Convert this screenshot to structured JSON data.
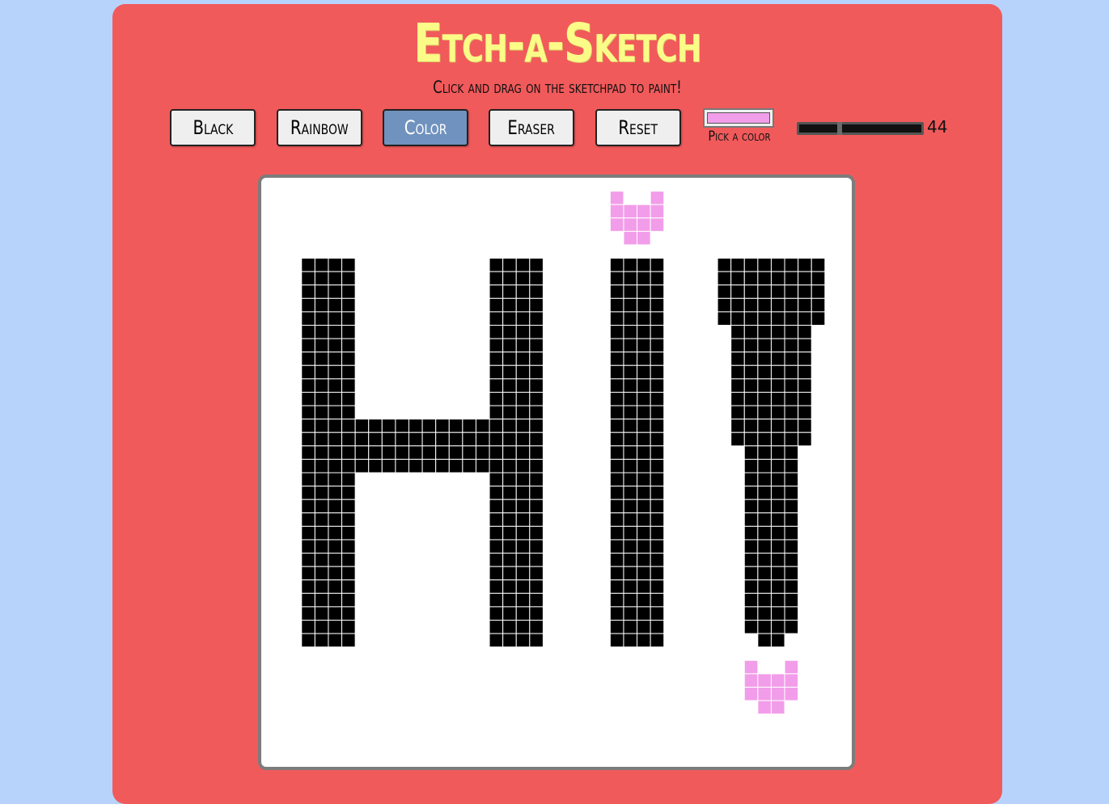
{
  "app": {
    "title": "Etch-a-Sketch",
    "subtitle": "Click and drag on the sketchpad to paint!"
  },
  "toolbar": {
    "buttons": [
      {
        "label": "Black",
        "active": false
      },
      {
        "label": "Rainbow",
        "active": false
      },
      {
        "label": "Color",
        "active": true
      },
      {
        "label": "Eraser",
        "active": false
      },
      {
        "label": "Reset",
        "active": false
      }
    ],
    "color_picker": {
      "label": "Pick a color",
      "value": "#f29de9"
    },
    "grid_size": {
      "value": "44",
      "min": 16,
      "max": 100
    }
  },
  "colors": {
    "page_background": "#b7d3fc",
    "panel": "#f15a5b",
    "title": "#fbfb88",
    "active_button": "#7092be",
    "ink": "#000000",
    "pink": "#f29de9",
    "cell_line": "#ffffff"
  },
  "sketchpad": {
    "grid": 44,
    "painted": [
      {
        "color": "pink",
        "rows": [
          1,
          1
        ],
        "cols": [
          26,
          26
        ]
      },
      {
        "color": "pink",
        "rows": [
          1,
          1
        ],
        "cols": [
          29,
          29
        ]
      },
      {
        "color": "pink",
        "rows": [
          2,
          3
        ],
        "cols": [
          26,
          29
        ]
      },
      {
        "color": "pink",
        "rows": [
          4,
          4
        ],
        "cols": [
          27,
          28
        ]
      },
      {
        "color": "ink",
        "rows": [
          6,
          34
        ],
        "cols": [
          3,
          6
        ]
      },
      {
        "color": "ink",
        "rows": [
          18,
          21
        ],
        "cols": [
          7,
          16
        ]
      },
      {
        "color": "ink",
        "rows": [
          6,
          34
        ],
        "cols": [
          17,
          20
        ]
      },
      {
        "color": "ink",
        "rows": [
          6,
          34
        ],
        "cols": [
          26,
          29
        ]
      },
      {
        "color": "ink",
        "rows": [
          6,
          10
        ],
        "cols": [
          34,
          41
        ]
      },
      {
        "color": "ink",
        "rows": [
          11,
          19
        ],
        "cols": [
          35,
          40
        ]
      },
      {
        "color": "ink",
        "rows": [
          20,
          33
        ],
        "cols": [
          36,
          39
        ]
      },
      {
        "color": "ink",
        "rows": [
          34,
          34
        ],
        "cols": [
          37,
          38
        ]
      },
      {
        "color": "pink",
        "rows": [
          36,
          36
        ],
        "cols": [
          36,
          36
        ]
      },
      {
        "color": "pink",
        "rows": [
          36,
          36
        ],
        "cols": [
          39,
          39
        ]
      },
      {
        "color": "pink",
        "rows": [
          37,
          38
        ],
        "cols": [
          36,
          39
        ]
      },
      {
        "color": "pink",
        "rows": [
          39,
          39
        ],
        "cols": [
          37,
          38
        ]
      }
    ]
  }
}
